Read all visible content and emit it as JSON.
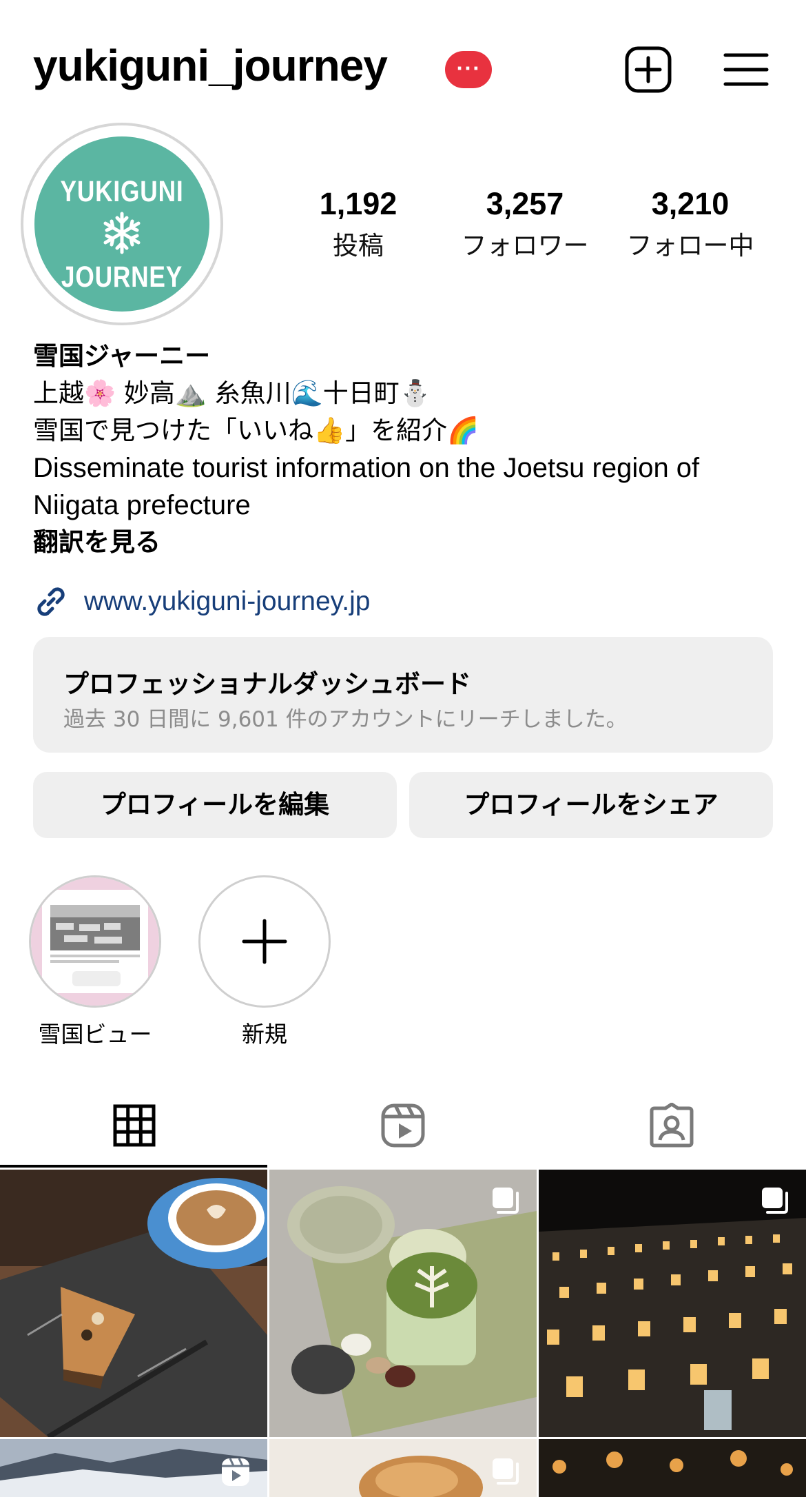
{
  "header": {
    "username": "yukiguni_journey",
    "more_badge": "···"
  },
  "avatar": {
    "logo_top": "YUKIGUNI",
    "logo_bottom": "JOURNEY",
    "colors": {
      "background": "#5bb6a2",
      "text": "#ffffff"
    }
  },
  "stats": [
    {
      "value": "1,192",
      "label": "投稿"
    },
    {
      "value": "3,257",
      "label": "フォロワー"
    },
    {
      "value": "3,210",
      "label": "フォロー中"
    }
  ],
  "bio": {
    "name": "雪国ジャーニー",
    "line1": "上越🌸 妙高⛰️ 糸魚川🌊十日町⛄",
    "line2": "雪国で見つけた「いいね👍」を紹介🌈",
    "line3": "Disseminate tourist information on the Joetsu region of",
    "line4": "Niigata prefecture",
    "translate": "翻訳を見る"
  },
  "link": {
    "url": "www.yukiguni-journey.jp",
    "icon": "link-icon",
    "color": "#173e79"
  },
  "dashboard": {
    "title": "プロフェッショナルダッシュボード",
    "subtitle": "過去 30 日間に 9,601 件のアカウントにリーチしました。"
  },
  "buttons": {
    "edit": "プロフィールを編集",
    "share": "プロフィールをシェア"
  },
  "highlights": [
    {
      "label": "雪国ビュー"
    },
    {
      "label": "新規"
    }
  ],
  "tabs": [
    {
      "icon": "grid-icon",
      "active": true
    },
    {
      "icon": "reels-icon",
      "active": false
    },
    {
      "icon": "tagged-icon",
      "active": false
    }
  ],
  "posts": [
    {
      "subject": "cake-and-latte",
      "badge": null
    },
    {
      "subject": "matcha-dessert-plate",
      "badge": "carousel-icon"
    },
    {
      "subject": "snow-lanterns-night",
      "badge": "carousel-icon"
    },
    {
      "subject": "snowy-mountains",
      "badge": "reels-icon"
    },
    {
      "subject": "bread",
      "badge": "carousel-icon"
    },
    {
      "subject": "lanterns",
      "badge": null
    }
  ],
  "colors": {
    "notification_red": "#e8323f",
    "button_gray": "#efefef",
    "muted_text": "#8c8c8c"
  }
}
